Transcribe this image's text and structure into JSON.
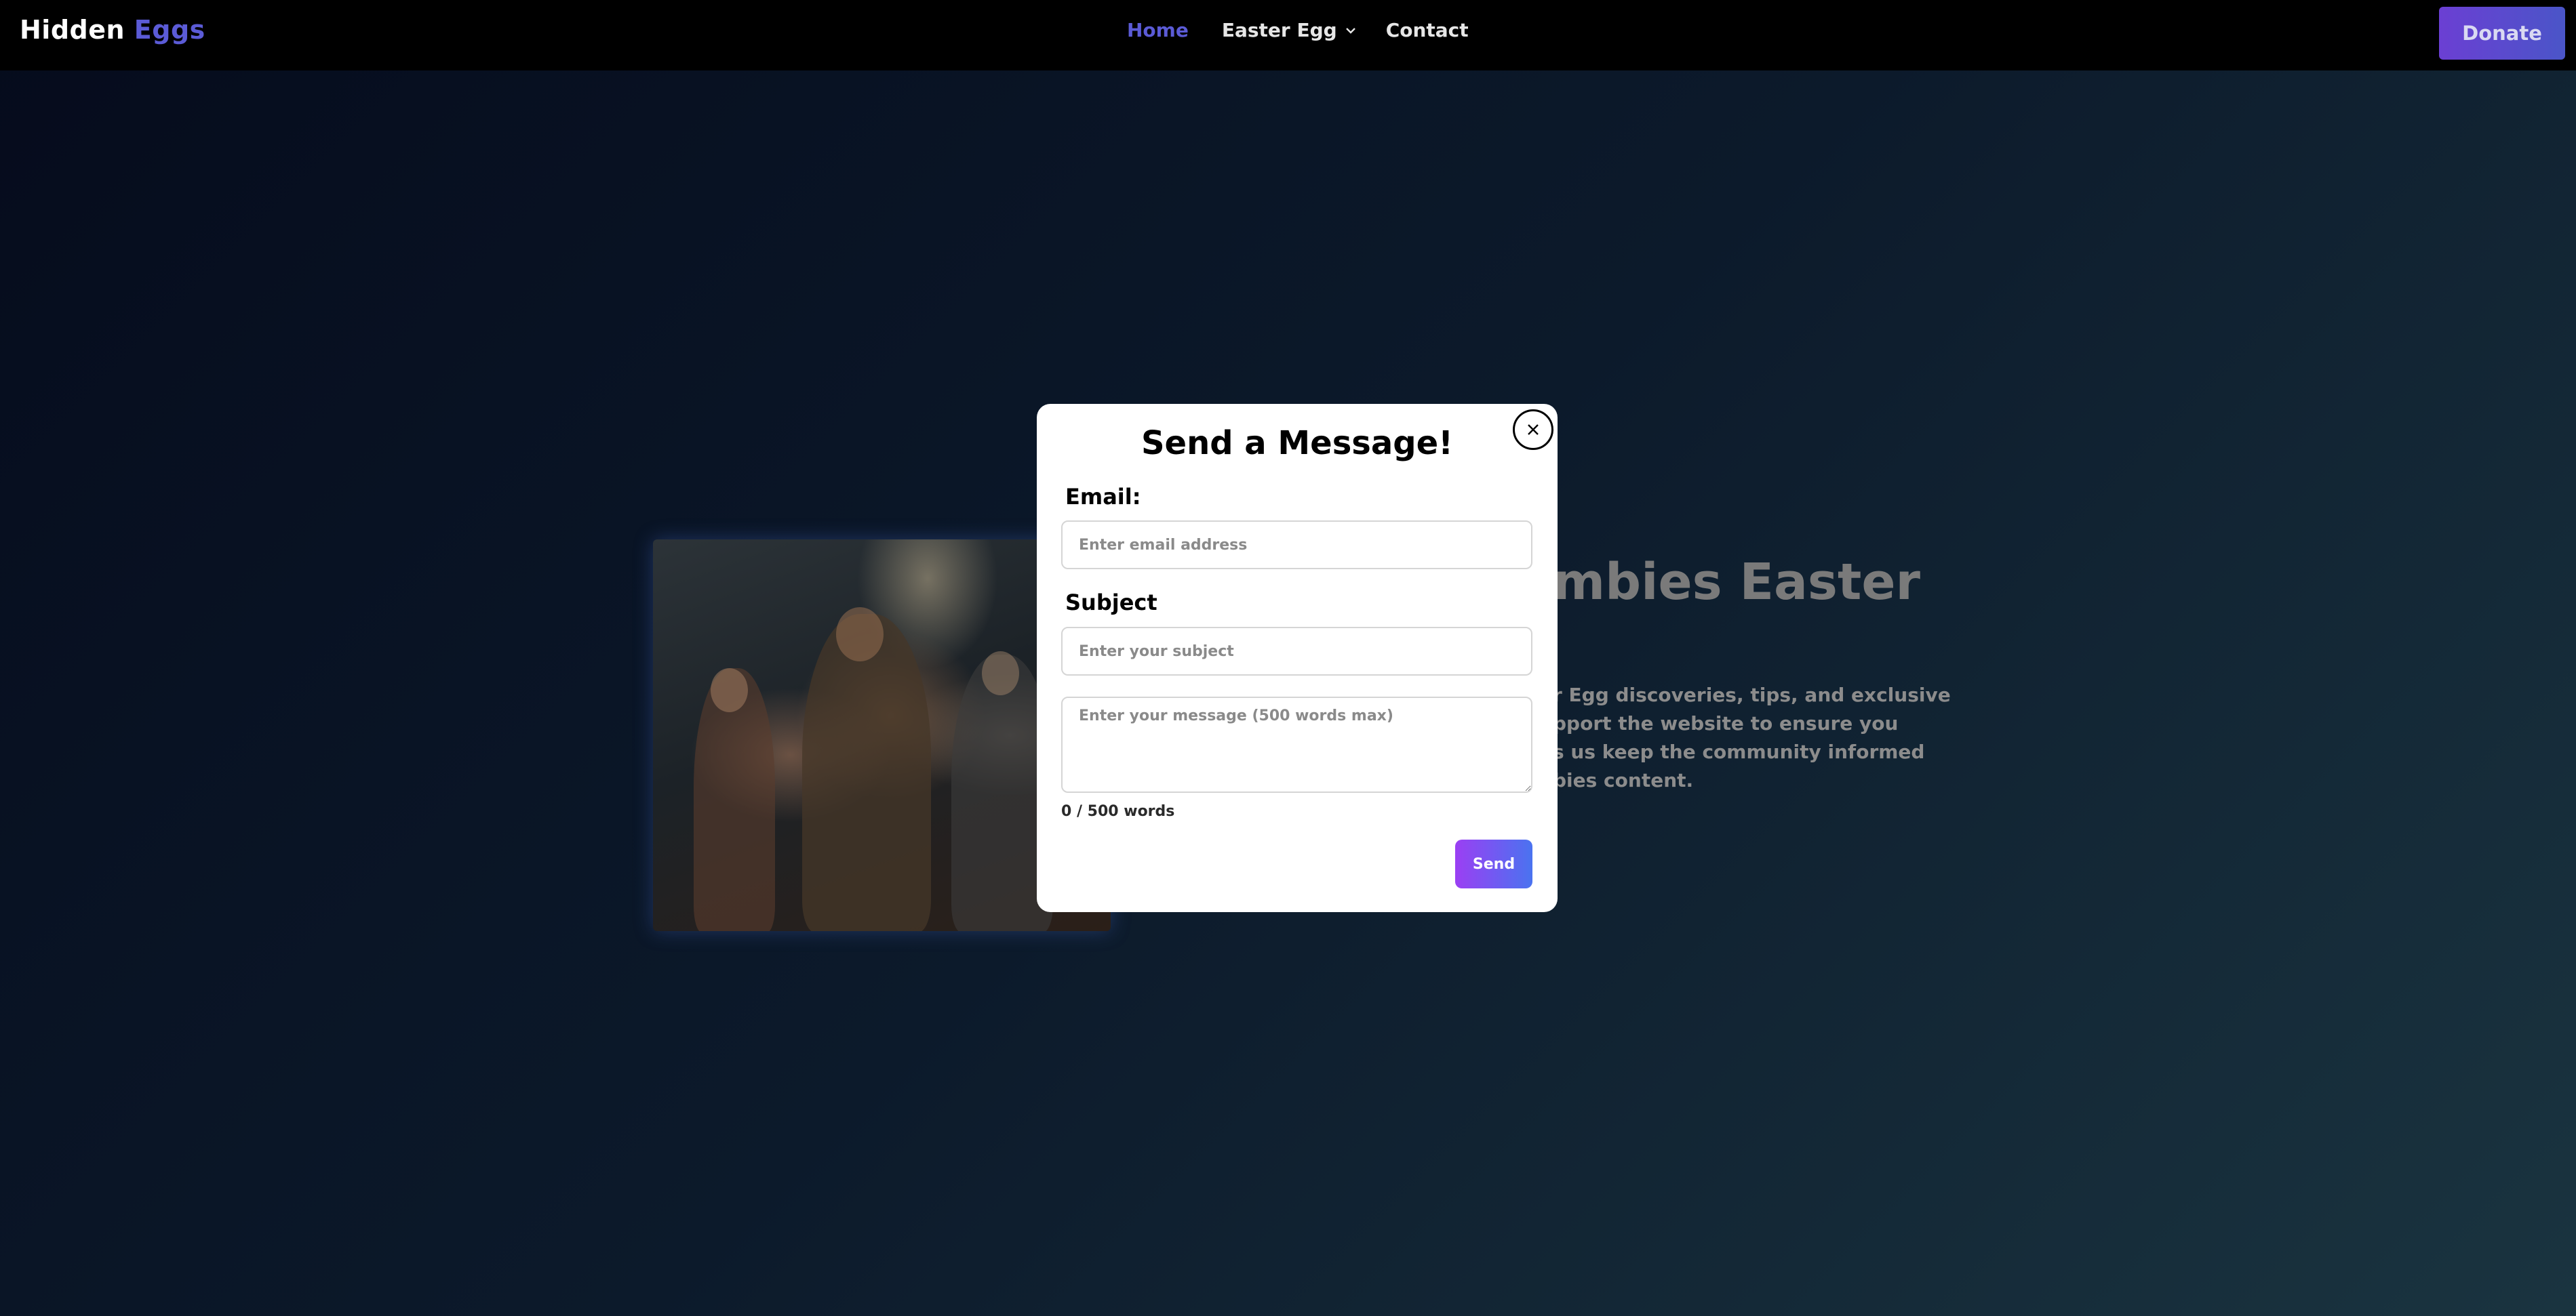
{
  "nav": {
    "logo_part1": "Hidden",
    "logo_part2": "Eggs",
    "links": [
      "Home",
      "Easter Egg",
      "Contact"
    ],
    "donate_label": "Donate",
    "accent_color": "#5b5bd6"
  },
  "hero": {
    "title_fragment": "mbies Easter",
    "text_lines": [
      "r Egg discoveries, tips, and exclusive",
      "pport the website to ensure you",
      "s us keep the community informed",
      "bies content."
    ]
  },
  "modal": {
    "title": "Send a Message!",
    "email_label": "Email:",
    "email_placeholder": "Enter email address",
    "subject_label": "Subject",
    "subject_placeholder": "Enter your subject",
    "message_placeholder": "Enter your message (500 words max)",
    "word_count": "0 / 500 words",
    "send_label": "Send"
  },
  "icons": {
    "close": "close-icon",
    "dropdown": "chevron-down-icon"
  }
}
